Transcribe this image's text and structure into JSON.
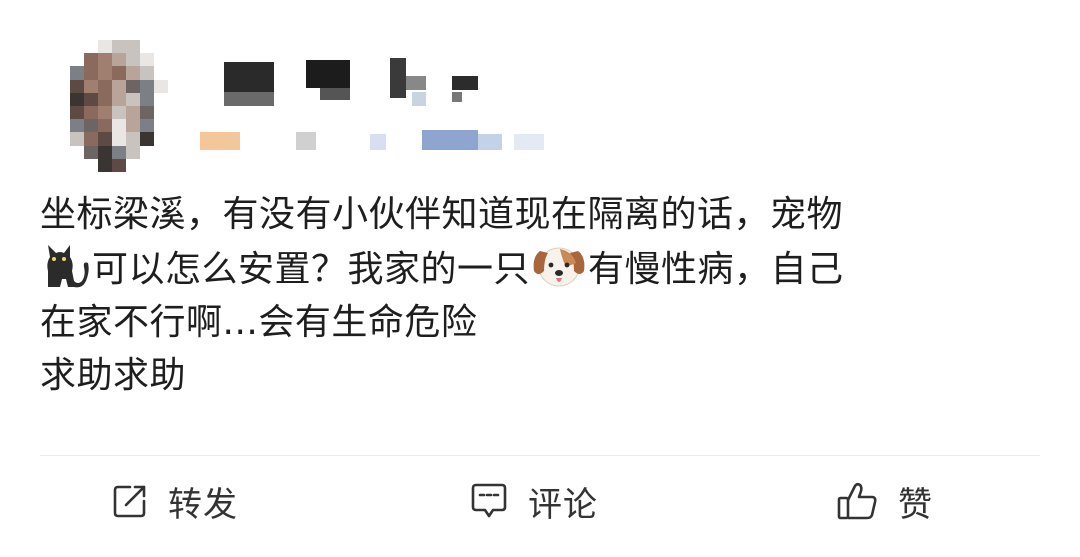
{
  "post": {
    "content_lines": [
      "坐标梁溪，有没有小伙伴知道现在隔离的话，宠物",
      "可以怎么安置？我家的一只",
      "有慢性病，自己",
      "在家不行啊...会有生命危险",
      "求助求助"
    ],
    "emojis": {
      "cat": "cat-emoji",
      "dog": "dog-face-emoji"
    }
  },
  "actions": {
    "repost_label": "转发",
    "comment_label": "评论",
    "like_label": "赞"
  },
  "colors": {
    "text": "#1e1e1e",
    "action_text": "#333333",
    "divider": "#ececec",
    "background": "#ffffff"
  }
}
